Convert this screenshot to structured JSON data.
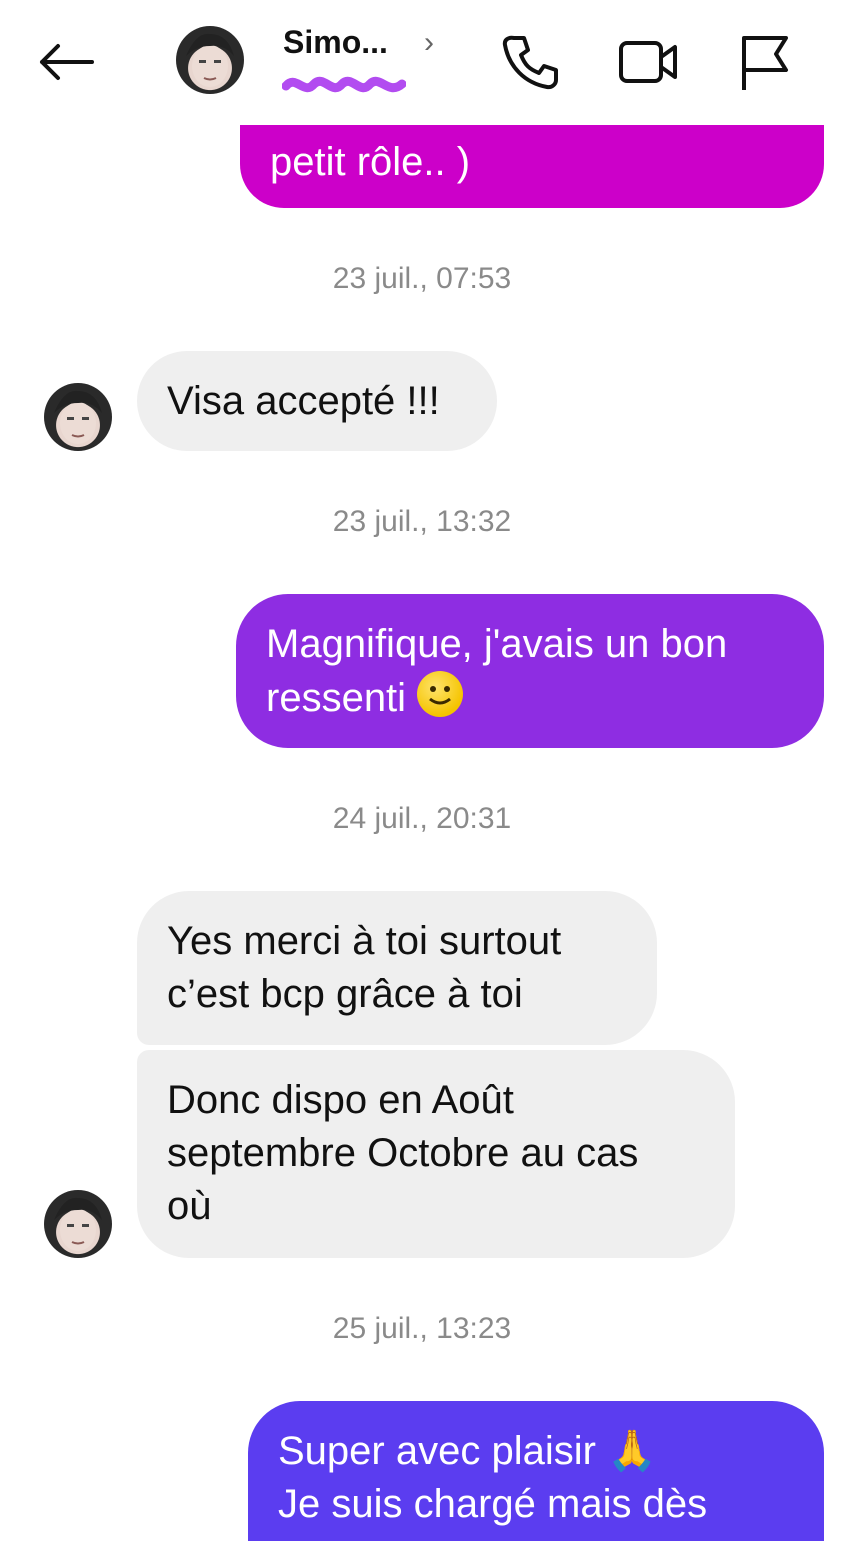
{
  "header": {
    "contact_name": "Simo...",
    "back_icon": "arrow-left-icon",
    "call_icon": "phone-icon",
    "video_icon": "video-camera-icon",
    "report_icon": "flag-icon"
  },
  "colors": {
    "magenta": "#cc00c9",
    "purple": "#8e2de2",
    "indigo": "#5b3df0",
    "incoming": "#efefef",
    "timestamp": "#8a8a8a"
  },
  "messages": [
    {
      "dir": "out",
      "text": "petit rôle.. )"
    },
    {
      "timestamp": "23 juil., 07:53"
    },
    {
      "dir": "in",
      "text": "Visa accepté !!!"
    },
    {
      "timestamp": "23 juil., 13:32"
    },
    {
      "dir": "out",
      "text_line1": "Magnifique, j'avais un bon",
      "text_line2": "ressenti"
    },
    {
      "timestamp": "24 juil., 20:31"
    },
    {
      "dir": "in",
      "text_line1": "Yes merci à toi surtout",
      "text_line2": "c’est bcp grâce à toi"
    },
    {
      "dir": "in",
      "text_line1": "Donc dispo en Août",
      "text_line2": "septembre Octobre au cas",
      "text_line3": "où"
    },
    {
      "timestamp": "25 juil., 13:23"
    },
    {
      "dir": "out",
      "text_line1": "Super avec plaisir 🙏",
      "text_line2": "Je suis chargé mais dès"
    }
  ]
}
